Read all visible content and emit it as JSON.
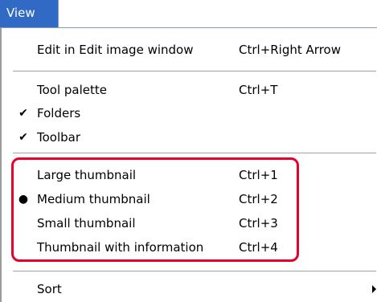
{
  "menu": {
    "title": "View"
  },
  "items": {
    "edit_window": {
      "label": "Edit in Edit image window",
      "shortcut": "Ctrl+Right Arrow"
    },
    "tool_palette": {
      "label": "Tool palette",
      "shortcut": "Ctrl+T"
    },
    "folders": {
      "label": "Folders",
      "checked": true
    },
    "toolbar": {
      "label": "Toolbar",
      "checked": true
    },
    "large_thumbnail": {
      "label": "Large thumbnail",
      "shortcut": "Ctrl+1"
    },
    "medium_thumbnail": {
      "label": "Medium thumbnail",
      "shortcut": "Ctrl+2",
      "selected": true
    },
    "small_thumbnail": {
      "label": "Small thumbnail",
      "shortcut": "Ctrl+3"
    },
    "thumbnail_info": {
      "label": "Thumbnail with information",
      "shortcut": "Ctrl+4"
    },
    "sort": {
      "label": "Sort",
      "has_submenu": true
    }
  },
  "glyphs": {
    "check": "✔",
    "bullet": "●"
  },
  "colors": {
    "menu_highlight": "#316ac5",
    "annotation_box": "#e8002a"
  }
}
